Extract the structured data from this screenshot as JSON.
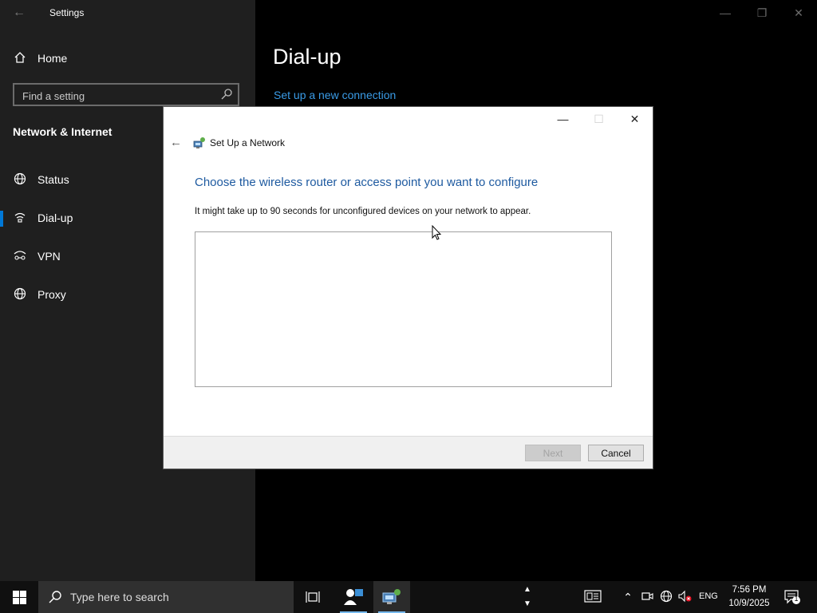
{
  "settings": {
    "window_title": "Settings",
    "nav_home": "Home",
    "search_placeholder": "Find a setting",
    "section_title": "Network & Internet",
    "nav_items": [
      {
        "label": "Status",
        "icon": "globe-icon"
      },
      {
        "label": "Dial-up",
        "icon": "dialup-icon"
      },
      {
        "label": "VPN",
        "icon": "vpn-icon"
      },
      {
        "label": "Proxy",
        "icon": "globe-icon"
      }
    ],
    "page_title": "Dial-up",
    "page_link": "Set up a new connection",
    "accent": "#0078d7"
  },
  "dialog": {
    "title": "Set Up a Network",
    "heading": "Choose the wireless router or access point you want to configure",
    "description": "It might take up to 90 seconds for unconfigured devices on your network to appear.",
    "next_label": "Next",
    "cancel_label": "Cancel"
  },
  "taskbar": {
    "search_placeholder": "Type here to search",
    "language": "ENG",
    "time": "7:56 PM",
    "date": "10/9/2025",
    "notification_count": "1"
  }
}
